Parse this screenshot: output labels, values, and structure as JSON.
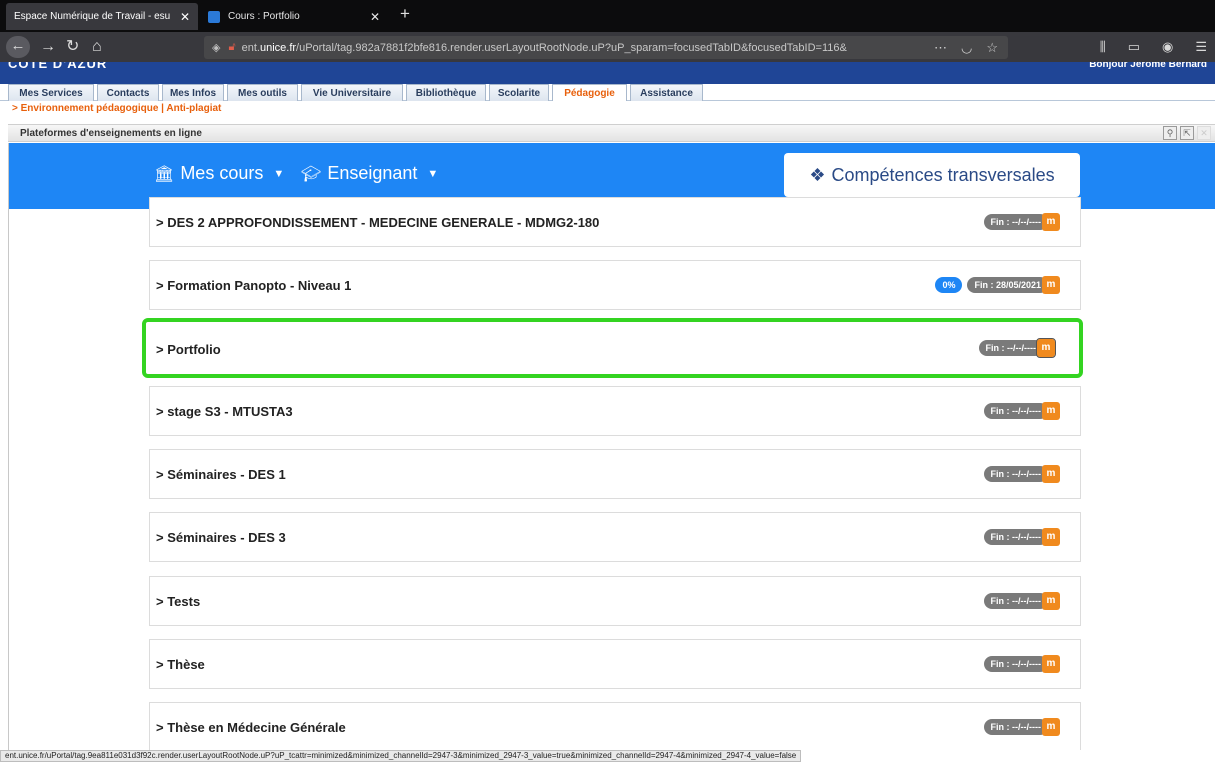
{
  "browser": {
    "tabs": [
      {
        "title": "Espace Numérique de Travail - esu",
        "active": true
      },
      {
        "title": "Cours : Portfolio",
        "active": false
      }
    ],
    "url_prefix": "ent.",
    "url_domain": "unice.fr",
    "url_rest": "/uPortal/tag.982a7881f2bfe816.render.userLayoutRootNode.uP?uP_sparam=focusedTabID&focusedTabID=116&",
    "status_url": "ent.unice.fr/uPortal/tag.9ea811e031d3f92c.render.userLayoutRootNode.uP?uP_tcattr=minimized&minimized_channelId=2947-3&minimized_2947-3_value=true&minimized_channelId=2947-4&minimized_2947-4_value=false"
  },
  "portal": {
    "logo": "CÔTE D'AZUR",
    "greeting": "Bonjour Jérôme Bernard",
    "tabs": [
      "Mes Services",
      "Contacts",
      "Mes Infos",
      "Mes outils",
      "Vie Universitaire",
      "Bibliothèque",
      "Scolarite",
      "Pédagogie",
      "Assistance"
    ],
    "active_tab": "Pédagogie",
    "subnav": "> Environnement pédagogique | Anti-plagiat",
    "channel_title": "Plateformes d'enseignements en ligne"
  },
  "moodle": {
    "menu_courses": "Mes cours",
    "menu_role": "Enseignant",
    "competences_button": "Compétences transversales",
    "courses": [
      {
        "name": "> DES 2 APPROFONDISSEMENT - MEDECINE GENERALE - MDMG2-180",
        "progress": "",
        "end": "Fin : --/--/----"
      },
      {
        "name": "> Formation Panopto - Niveau 1",
        "progress": "0%",
        "end": "Fin : 28/05/2021"
      },
      {
        "name": "> Portfolio",
        "progress": "",
        "end": "Fin : --/--/----"
      },
      {
        "name": "> stage S3 - MTUSTA3",
        "progress": "",
        "end": "Fin : --/--/----"
      },
      {
        "name": "> Séminaires - DES 1",
        "progress": "",
        "end": "Fin : --/--/----"
      },
      {
        "name": "> Séminaires - DES 3",
        "progress": "",
        "end": "Fin : --/--/----"
      },
      {
        "name": "> Tests",
        "progress": "",
        "end": "Fin : --/--/----"
      },
      {
        "name": "> Thèse",
        "progress": "",
        "end": "Fin : --/--/----"
      },
      {
        "name": "> Thèse en Médecine Générale",
        "progress": "",
        "end": "Fin : --/--/----"
      }
    ]
  },
  "colors": {
    "accent_blue": "#1e86f5",
    "highlight_green": "#34d421",
    "portal_orange": "#e8600c",
    "moodle_orange": "#f08a1e"
  }
}
